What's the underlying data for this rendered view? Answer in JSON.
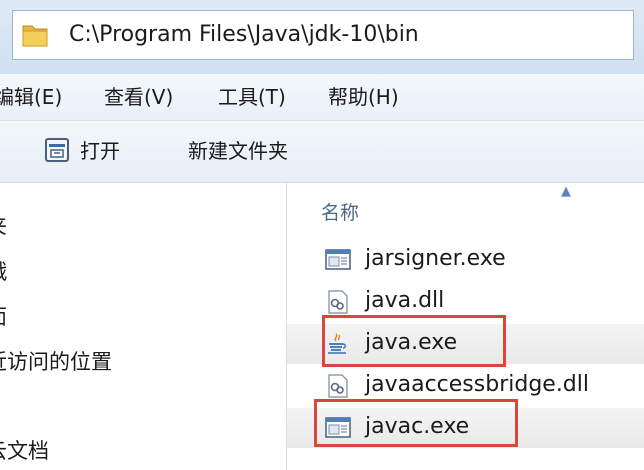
{
  "window": {
    "address_path": "C:\\Program Files\\Java\\jdk-10\\bin"
  },
  "menu": {
    "items": [
      {
        "label": "编辑(E)"
      },
      {
        "label": "查看(V)"
      },
      {
        "label": "工具(T)"
      },
      {
        "label": "帮助(H)"
      }
    ]
  },
  "toolbar": {
    "open_label": "打开",
    "new_folder_label": "新建文件夹"
  },
  "nav_pane": {
    "items": [
      {
        "label": "夹"
      },
      {
        "label": "戱"
      },
      {
        "label": "面"
      },
      {
        "label": "近访问的位置"
      },
      {
        "label": "云文档"
      }
    ]
  },
  "file_list": {
    "column_name": "名称",
    "files": [
      {
        "name": "jarsigner.exe",
        "icon": "exe-app-icon",
        "highlighted": false
      },
      {
        "name": "java.dll",
        "icon": "dll-icon",
        "highlighted": false
      },
      {
        "name": "java.exe",
        "icon": "java-exe-icon",
        "highlighted": true
      },
      {
        "name": "javaaccessbridge.dll",
        "icon": "dll-icon",
        "highlighted": false
      },
      {
        "name": "javac.exe",
        "icon": "exe-app-icon",
        "highlighted": true
      }
    ]
  },
  "colors": {
    "highlight": "#d9473a",
    "header_text": "#4d6a8c"
  }
}
